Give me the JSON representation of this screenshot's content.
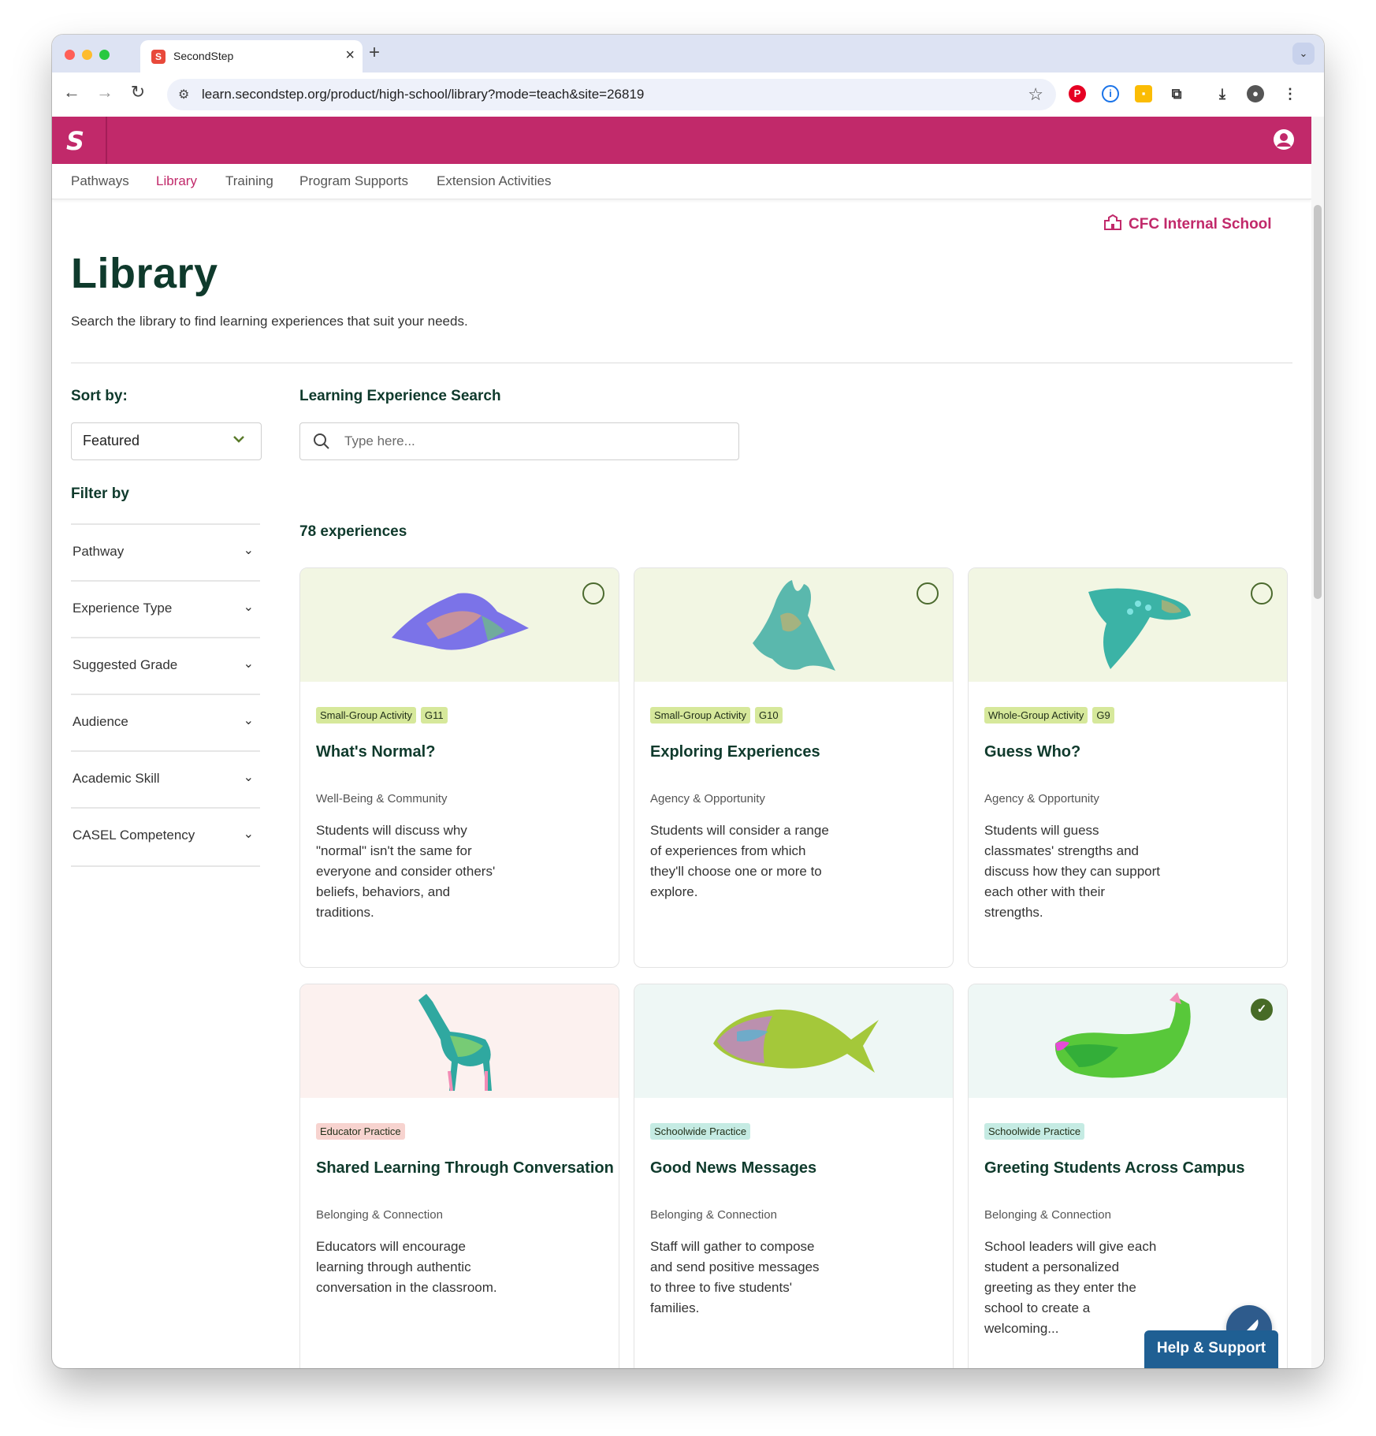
{
  "browser": {
    "tab_title": "SecondStep",
    "tab_favicon": "S",
    "url": "learn.secondstep.org/product/high-school/library?mode=teach&site=26819"
  },
  "nav": {
    "items": [
      "Pathways",
      "Library",
      "Training",
      "Program Supports",
      "Extension Activities"
    ],
    "active": "Library"
  },
  "school": "CFC Internal School",
  "page": {
    "title": "Library",
    "subtitle": "Search the library to find learning experiences that suit your needs."
  },
  "sort": {
    "label": "Sort by:",
    "value": "Featured"
  },
  "search": {
    "label": "Learning Experience Search",
    "placeholder": "Type here..."
  },
  "filter": {
    "label": "Filter by",
    "items": [
      "Pathway",
      "Experience Type",
      "Suggested Grade",
      "Audience",
      "Academic Skill",
      "CASEL Competency"
    ]
  },
  "results_count": "78 experiences",
  "cards": [
    {
      "badges": [
        "Small-Group Activity",
        "G11"
      ],
      "title": "What's Normal?",
      "category": "Well-Being & Community",
      "description": "Students will discuss why \"normal\" isn't the same for everyone and consider others' beliefs, behaviors, and traditions.",
      "selected": false,
      "icon": "bird-flying-icon",
      "hero_color": "#f2f6e3"
    },
    {
      "badges": [
        "Small-Group Activity",
        "G10"
      ],
      "title": "Exploring Experiences",
      "category": "Agency & Opportunity",
      "description": "Students will consider a range of experiences from which they'll choose one or more to explore.",
      "selected": false,
      "icon": "dove-icon",
      "hero_color": "#f2f6e3"
    },
    {
      "badges": [
        "Whole-Group Activity",
        "G9"
      ],
      "title": "Guess Who?",
      "category": "Agency & Opportunity",
      "description": "Students will guess classmates' strengths and discuss how they can support each other with their strengths.",
      "selected": false,
      "icon": "owl-icon",
      "hero_color": "#f2f6e3"
    },
    {
      "badges": [
        "Educator Practice"
      ],
      "title": "Shared Learning Through Conversation",
      "category": "Belonging & Connection",
      "description": "Educators will encourage learning through authentic conversation in the classroom.",
      "selected": false,
      "icon": "giraffe-icon",
      "hero_color": "#fcf1ef"
    },
    {
      "badges": [
        "Schoolwide Practice"
      ],
      "title": "Good News Messages",
      "category": "Belonging & Connection",
      "description": "Staff will gather to compose and send positive messages to three to five students' families.",
      "selected": false,
      "icon": "fish-icon",
      "hero_color": "#eef7f5"
    },
    {
      "badges": [
        "Schoolwide Practice"
      ],
      "title": "Greeting Students Across Campus",
      "category": "Belonging & Connection",
      "description": "School leaders will give each student a personalized greeting as they enter the school to create a welcoming...",
      "selected": true,
      "icon": "whale-icon",
      "hero_color": "#eef7f5"
    }
  ],
  "help": {
    "label": "Help & Support"
  },
  "colors": {
    "brand": "#c1296a",
    "heading": "#0f3a2c",
    "badge_activity": "#d6e89b",
    "badge_educator": "#f7d3cf",
    "badge_schoolwide": "#c5ebe3",
    "help": "#1f5f93"
  }
}
